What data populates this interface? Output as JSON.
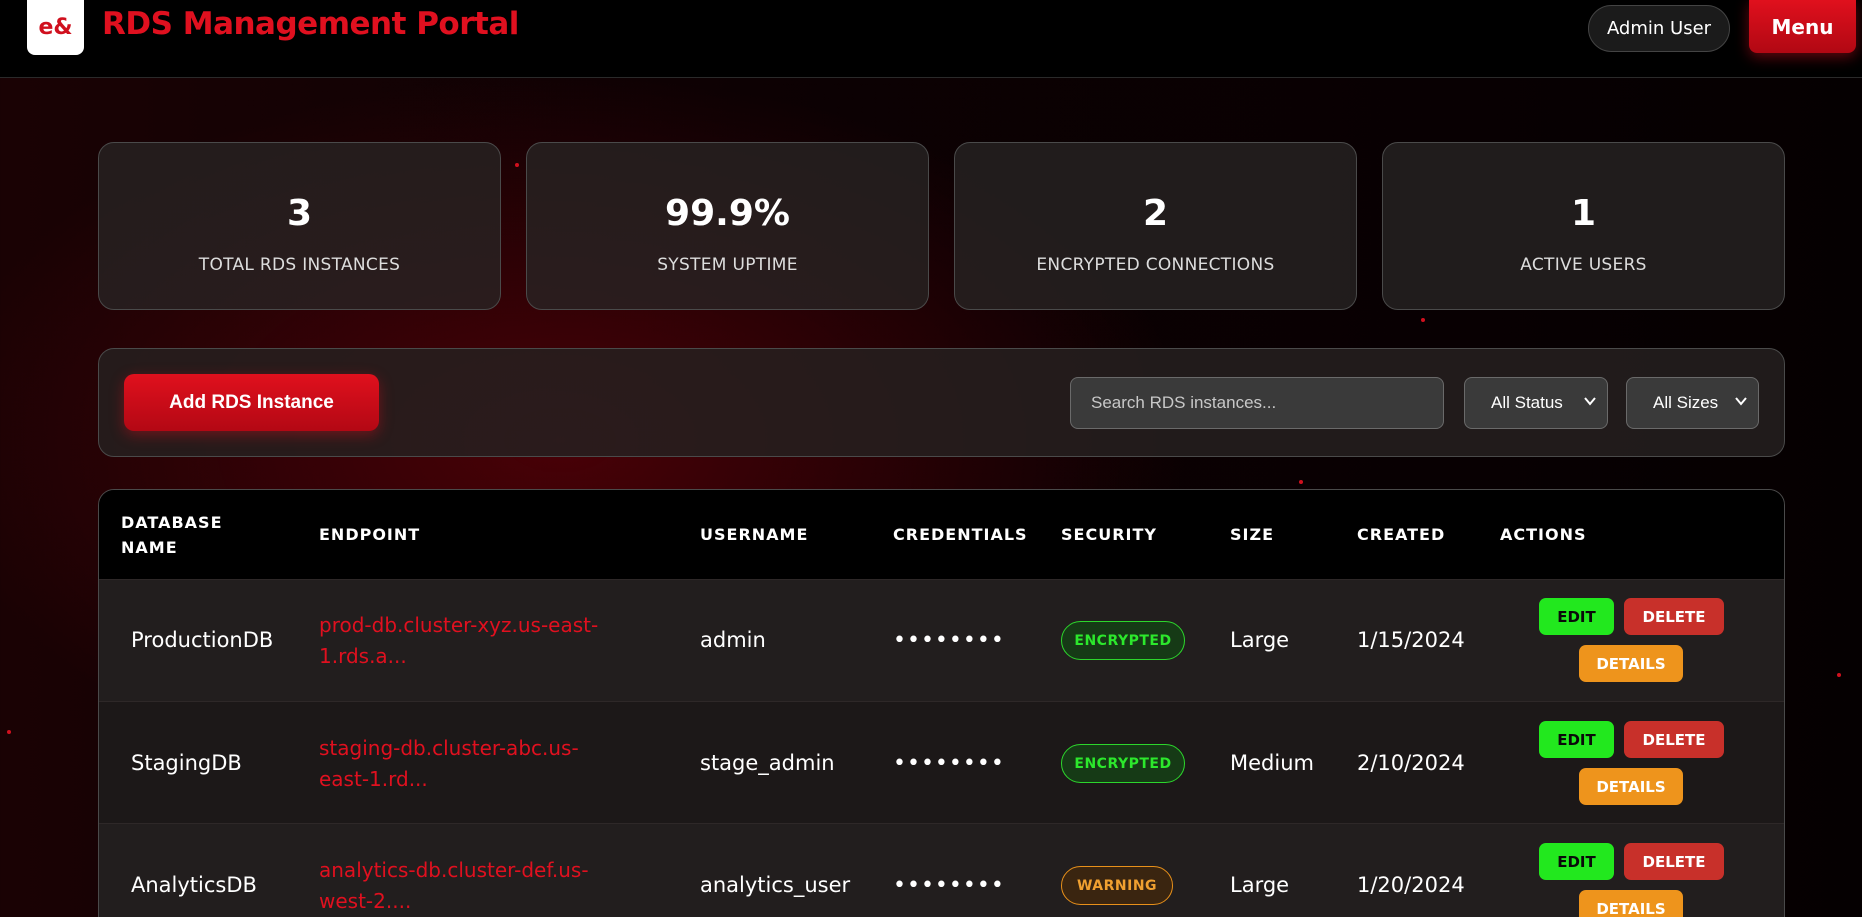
{
  "header": {
    "logo_text": "e&",
    "title": "RDS Management Portal",
    "user_label": "Admin User",
    "menu_label": "Menu"
  },
  "stats": [
    {
      "value": "3",
      "label": "TOTAL RDS INSTANCES"
    },
    {
      "value": "99.9%",
      "label": "SYSTEM UPTIME"
    },
    {
      "value": "2",
      "label": "ENCRYPTED CONNECTIONS"
    },
    {
      "value": "1",
      "label": "ACTIVE USERS"
    }
  ],
  "toolbar": {
    "add_label": "Add RDS Instance",
    "search_placeholder": "Search RDS instances...",
    "status_filter": "All Status",
    "size_filter": "All Sizes"
  },
  "table": {
    "headers": {
      "name_line1": "DATABASE",
      "name_line2": "NAME",
      "endpoint": "ENDPOINT",
      "username": "USERNAME",
      "credentials": "CREDENTIALS",
      "security": "SECURITY",
      "size": "SIZE",
      "created": "CREATED",
      "actions": "ACTIONS"
    },
    "rows": [
      {
        "name": "ProductionDB",
        "endpoint_line1": "prod-db.cluster-xyz.us-east-",
        "endpoint_line2": "1.rds.a...",
        "username": "admin",
        "credentials": "••••••••",
        "security": "ENCRYPTED",
        "size": "Large",
        "created": "1/15/2024"
      },
      {
        "name": "StagingDB",
        "endpoint_line1": "staging-db.cluster-abc.us-",
        "endpoint_line2": "east-1.rd...",
        "username": "stage_admin",
        "credentials": "••••••••",
        "security": "ENCRYPTED",
        "size": "Medium",
        "created": "2/10/2024"
      },
      {
        "name": "AnalyticsDB",
        "endpoint_line1": "analytics-db.cluster-def.us-",
        "endpoint_line2": "west-2....",
        "username": "analytics_user",
        "credentials": "••••••••",
        "security": "WARNING",
        "size": "Large",
        "created": "1/20/2024"
      }
    ],
    "actions": {
      "edit": "EDIT",
      "delete": "DELETE",
      "details": "DETAILS"
    }
  },
  "colors": {
    "accent": "#e0101f",
    "encrypted": "#2ce82c",
    "warning": "#f0a030",
    "edit": "#22e81e",
    "delete": "#c8302a",
    "details": "#ee941c"
  }
}
